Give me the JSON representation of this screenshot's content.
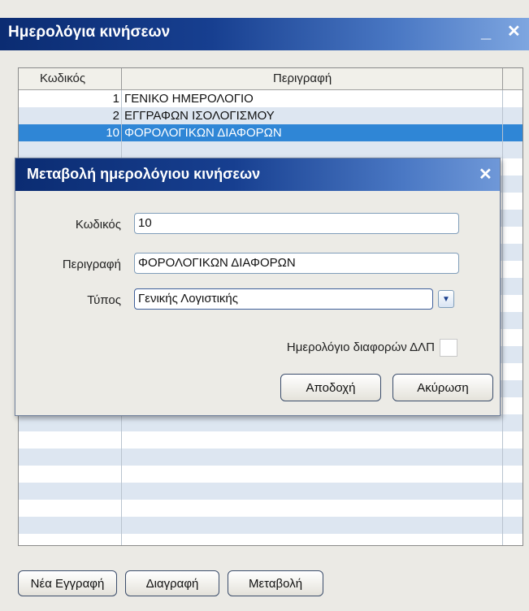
{
  "window": {
    "title": "Ημερολόγια κινήσεων",
    "minimize": "_",
    "close": "✕"
  },
  "grid": {
    "headers": {
      "code": "Κωδικός",
      "description": "Περιγραφή"
    },
    "rows": [
      {
        "code": "1",
        "description": "ΓΕΝΙΚΟ ΗΜΕΡΟΛΟΓΙΟ"
      },
      {
        "code": "2",
        "description": "ΕΓΓΡΑΦΩΝ ΙΣΟΛΟΓΙΣΜΟΥ"
      },
      {
        "code": "10",
        "description": "ΦΟΡΟΛΟΓΙΚΩΝ ΔΙΑΦΟΡΩΝ"
      }
    ],
    "selected_row": 2
  },
  "buttons": {
    "new": "Νέα Εγγραφή",
    "delete": "Διαγραφή",
    "edit": "Μεταβολή"
  },
  "dialog": {
    "title": "Μεταβολή ημερολόγιου κινήσεων",
    "close": "✕",
    "code_label": "Κωδικός",
    "code_value": "10",
    "desc_label": "Περιγραφή",
    "desc_value": "ΦΟΡΟΛΟΓΙΚΩΝ ΔΙΑΦΟΡΩΝ",
    "type_label": "Τύπος",
    "type_value": "Γενικής Λογιστικής",
    "diff_label": "Ημερολόγιο διαφορών ΔΛΠ",
    "diff_checked": false,
    "ok": "Αποδοχή",
    "cancel": "Ακύρωση"
  },
  "colors": {
    "title_bar": "#173f90",
    "selection": "#2f86d6",
    "alt_row": "#dde6f1"
  }
}
